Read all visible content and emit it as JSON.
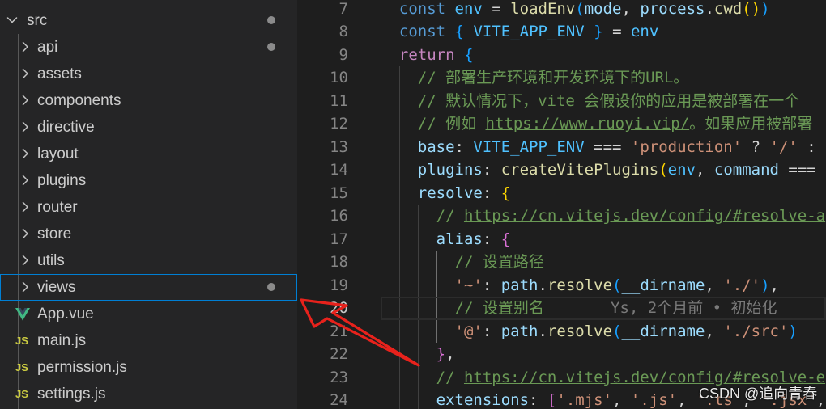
{
  "explorer": {
    "root": {
      "label": "src",
      "expanded": true,
      "dot": true
    },
    "folders": [
      {
        "label": "api",
        "dot": true
      },
      {
        "label": "assets"
      },
      {
        "label": "components"
      },
      {
        "label": "directive"
      },
      {
        "label": "layout"
      },
      {
        "label": "plugins"
      },
      {
        "label": "router"
      },
      {
        "label": "store"
      },
      {
        "label": "utils"
      },
      {
        "label": "views",
        "dot": true,
        "selected": true
      }
    ],
    "files": [
      {
        "label": "App.vue",
        "icon": "vue-icon"
      },
      {
        "label": "main.js",
        "icon": "js-icon",
        "icon_text": "JS"
      },
      {
        "label": "permission.js",
        "icon": "js-icon",
        "icon_text": "JS"
      },
      {
        "label": "settings.js",
        "icon": "js-icon",
        "icon_text": "JS"
      }
    ]
  },
  "editor": {
    "syntax_colors": {
      "kw": "#569cd6",
      "ctl": "#c586c0",
      "var": "#9cdcfe",
      "const": "#4fc1ff",
      "prop": "#9cdcfe",
      "fn": "#dcdcaa",
      "op": "#d4d4d4",
      "str": "#ce9178",
      "cm": "#6a9955",
      "link": "#6a9955",
      "b3": "#179fff",
      "b4": "#ffd700",
      "b5": "#da70d6",
      "b6": "#179fff"
    },
    "lines": [
      {
        "n": "7",
        "tokens": [
          [
            "  ",
            "op"
          ],
          [
            "const",
            "kw"
          ],
          [
            " ",
            "op"
          ],
          [
            "env",
            "const"
          ],
          [
            " = ",
            "op"
          ],
          [
            "loadEnv",
            "fn"
          ],
          [
            "(",
            "b3"
          ],
          [
            "mode",
            "var"
          ],
          [
            ", ",
            "op"
          ],
          [
            "process",
            "var"
          ],
          [
            ".",
            "op"
          ],
          [
            "cwd",
            "fn"
          ],
          [
            "()",
            "b4"
          ],
          [
            ")",
            "b3"
          ]
        ]
      },
      {
        "n": "8",
        "tokens": [
          [
            "  ",
            "op"
          ],
          [
            "const",
            "kw"
          ],
          [
            " ",
            "op"
          ],
          [
            "{",
            "b3"
          ],
          [
            " ",
            "op"
          ],
          [
            "VITE_APP_ENV",
            "const"
          ],
          [
            " ",
            "op"
          ],
          [
            "}",
            "b3"
          ],
          [
            " = ",
            "op"
          ],
          [
            "env",
            "const"
          ]
        ]
      },
      {
        "n": "9",
        "tokens": [
          [
            "  ",
            "op"
          ],
          [
            "return",
            "ctl"
          ],
          [
            " ",
            "op"
          ],
          [
            "{",
            "b3"
          ]
        ]
      },
      {
        "n": "10",
        "tokens": [
          [
            "    ",
            "op"
          ],
          [
            "// 部署生产环境和开发环境下的URL。",
            "cm"
          ]
        ]
      },
      {
        "n": "11",
        "tokens": [
          [
            "    ",
            "op"
          ],
          [
            "// 默认情况下，vite 会假设你的应用是被部署在一个",
            "cm"
          ]
        ]
      },
      {
        "n": "12",
        "tokens": [
          [
            "    ",
            "op"
          ],
          [
            "// 例如 ",
            "cm"
          ],
          [
            "https://www.ruoyi.vip/",
            "link"
          ],
          [
            "。如果应用被部署",
            "cm"
          ]
        ]
      },
      {
        "n": "13",
        "tokens": [
          [
            "    ",
            "op"
          ],
          [
            "base",
            "prop"
          ],
          [
            ": ",
            "op"
          ],
          [
            "VITE_APP_ENV",
            "const"
          ],
          [
            " === ",
            "op"
          ],
          [
            "'production'",
            "str"
          ],
          [
            " ? ",
            "op"
          ],
          [
            "'/'",
            "str"
          ],
          [
            " :",
            "op"
          ]
        ]
      },
      {
        "n": "14",
        "tokens": [
          [
            "    ",
            "op"
          ],
          [
            "plugins",
            "prop"
          ],
          [
            ": ",
            "op"
          ],
          [
            "createVitePlugins",
            "fn"
          ],
          [
            "(",
            "b4"
          ],
          [
            "env",
            "const"
          ],
          [
            ", ",
            "op"
          ],
          [
            "command",
            "var"
          ],
          [
            " ===",
            "op"
          ]
        ]
      },
      {
        "n": "15",
        "tokens": [
          [
            "    ",
            "op"
          ],
          [
            "resolve",
            "prop"
          ],
          [
            ": ",
            "op"
          ],
          [
            "{",
            "b4"
          ]
        ]
      },
      {
        "n": "16",
        "tokens": [
          [
            "      ",
            "op"
          ],
          [
            "// ",
            "cm"
          ],
          [
            "https://cn.vitejs.dev/config/#resolve-a",
            "link"
          ]
        ]
      },
      {
        "n": "17",
        "tokens": [
          [
            "      ",
            "op"
          ],
          [
            "alias",
            "prop"
          ],
          [
            ": ",
            "op"
          ],
          [
            "{",
            "b5"
          ]
        ]
      },
      {
        "n": "18",
        "tokens": [
          [
            "        ",
            "op"
          ],
          [
            "// 设置路径",
            "cm"
          ]
        ]
      },
      {
        "n": "19",
        "tokens": [
          [
            "        ",
            "op"
          ],
          [
            "'~'",
            "str"
          ],
          [
            ": ",
            "op"
          ],
          [
            "path",
            "var"
          ],
          [
            ".",
            "op"
          ],
          [
            "resolve",
            "fn"
          ],
          [
            "(",
            "b6"
          ],
          [
            "__dirname",
            "var"
          ],
          [
            ", ",
            "op"
          ],
          [
            "'./'",
            "str"
          ],
          [
            ")",
            "b6"
          ],
          [
            ",",
            "op"
          ]
        ]
      },
      {
        "n": "20",
        "active": true,
        "tokens": [
          [
            "        ",
            "op"
          ],
          [
            "// 设置别名",
            "cm"
          ]
        ]
      },
      {
        "n": "21",
        "tokens": [
          [
            "        ",
            "op"
          ],
          [
            "'@'",
            "str"
          ],
          [
            ": ",
            "op"
          ],
          [
            "path",
            "var"
          ],
          [
            ".",
            "op"
          ],
          [
            "resolve",
            "fn"
          ],
          [
            "(",
            "b6"
          ],
          [
            "__dirname",
            "var"
          ],
          [
            ", ",
            "op"
          ],
          [
            "'./src'",
            "str"
          ],
          [
            ")",
            "b6"
          ]
        ]
      },
      {
        "n": "22",
        "tokens": [
          [
            "      ",
            "op"
          ],
          [
            "}",
            "b5"
          ],
          [
            ",",
            "op"
          ]
        ]
      },
      {
        "n": "23",
        "tokens": [
          [
            "      ",
            "op"
          ],
          [
            "// ",
            "cm"
          ],
          [
            "https://cn.vitejs.dev/config/#resolve-e",
            "link"
          ]
        ]
      },
      {
        "n": "24",
        "tokens": [
          [
            "      ",
            "op"
          ],
          [
            "extensions",
            "prop"
          ],
          [
            ": ",
            "op"
          ],
          [
            "[",
            "b5"
          ],
          [
            "'.mjs'",
            "str"
          ],
          [
            ", ",
            "op"
          ],
          [
            "'.js'",
            "str"
          ],
          [
            ", ",
            "op"
          ],
          [
            "'.ts'",
            "str"
          ],
          [
            ", ",
            "op"
          ],
          [
            "'.jsx'",
            "str"
          ],
          [
            ",",
            "op"
          ]
        ]
      }
    ],
    "blame": {
      "text": "Ys, 2个月前 • 初始化"
    }
  },
  "annotation": {
    "arrow_color": "#e8221c",
    "target": "views"
  },
  "watermark": "CSDN @追向青春",
  "theme": {
    "sidebar_bg": "#252526",
    "editor_bg": "#1e1e1e",
    "focus_border": "#007fd4",
    "js_icon": "#cbcb41",
    "vue_icon": "#41b883"
  }
}
